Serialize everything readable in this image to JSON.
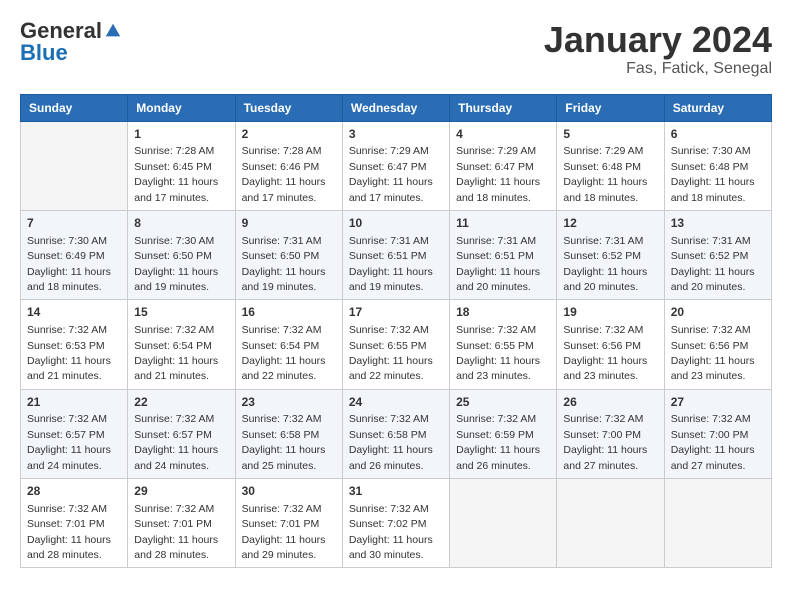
{
  "header": {
    "logo_general": "General",
    "logo_blue": "Blue",
    "month_year": "January 2024",
    "location": "Fas, Fatick, Senegal"
  },
  "days_of_week": [
    "Sunday",
    "Monday",
    "Tuesday",
    "Wednesday",
    "Thursday",
    "Friday",
    "Saturday"
  ],
  "weeks": [
    [
      {
        "day": "",
        "empty": true
      },
      {
        "day": "1",
        "sunrise": "7:28 AM",
        "sunset": "6:45 PM",
        "daylight": "11 hours and 17 minutes."
      },
      {
        "day": "2",
        "sunrise": "7:28 AM",
        "sunset": "6:46 PM",
        "daylight": "11 hours and 17 minutes."
      },
      {
        "day": "3",
        "sunrise": "7:29 AM",
        "sunset": "6:47 PM",
        "daylight": "11 hours and 17 minutes."
      },
      {
        "day": "4",
        "sunrise": "7:29 AM",
        "sunset": "6:47 PM",
        "daylight": "11 hours and 18 minutes."
      },
      {
        "day": "5",
        "sunrise": "7:29 AM",
        "sunset": "6:48 PM",
        "daylight": "11 hours and 18 minutes."
      },
      {
        "day": "6",
        "sunrise": "7:30 AM",
        "sunset": "6:48 PM",
        "daylight": "11 hours and 18 minutes."
      }
    ],
    [
      {
        "day": "7",
        "sunrise": "7:30 AM",
        "sunset": "6:49 PM",
        "daylight": "11 hours and 18 minutes."
      },
      {
        "day": "8",
        "sunrise": "7:30 AM",
        "sunset": "6:50 PM",
        "daylight": "11 hours and 19 minutes."
      },
      {
        "day": "9",
        "sunrise": "7:31 AM",
        "sunset": "6:50 PM",
        "daylight": "11 hours and 19 minutes."
      },
      {
        "day": "10",
        "sunrise": "7:31 AM",
        "sunset": "6:51 PM",
        "daylight": "11 hours and 19 minutes."
      },
      {
        "day": "11",
        "sunrise": "7:31 AM",
        "sunset": "6:51 PM",
        "daylight": "11 hours and 20 minutes."
      },
      {
        "day": "12",
        "sunrise": "7:31 AM",
        "sunset": "6:52 PM",
        "daylight": "11 hours and 20 minutes."
      },
      {
        "day": "13",
        "sunrise": "7:31 AM",
        "sunset": "6:52 PM",
        "daylight": "11 hours and 20 minutes."
      }
    ],
    [
      {
        "day": "14",
        "sunrise": "7:32 AM",
        "sunset": "6:53 PM",
        "daylight": "11 hours and 21 minutes."
      },
      {
        "day": "15",
        "sunrise": "7:32 AM",
        "sunset": "6:54 PM",
        "daylight": "11 hours and 21 minutes."
      },
      {
        "day": "16",
        "sunrise": "7:32 AM",
        "sunset": "6:54 PM",
        "daylight": "11 hours and 22 minutes."
      },
      {
        "day": "17",
        "sunrise": "7:32 AM",
        "sunset": "6:55 PM",
        "daylight": "11 hours and 22 minutes."
      },
      {
        "day": "18",
        "sunrise": "7:32 AM",
        "sunset": "6:55 PM",
        "daylight": "11 hours and 23 minutes."
      },
      {
        "day": "19",
        "sunrise": "7:32 AM",
        "sunset": "6:56 PM",
        "daylight": "11 hours and 23 minutes."
      },
      {
        "day": "20",
        "sunrise": "7:32 AM",
        "sunset": "6:56 PM",
        "daylight": "11 hours and 23 minutes."
      }
    ],
    [
      {
        "day": "21",
        "sunrise": "7:32 AM",
        "sunset": "6:57 PM",
        "daylight": "11 hours and 24 minutes."
      },
      {
        "day": "22",
        "sunrise": "7:32 AM",
        "sunset": "6:57 PM",
        "daylight": "11 hours and 24 minutes."
      },
      {
        "day": "23",
        "sunrise": "7:32 AM",
        "sunset": "6:58 PM",
        "daylight": "11 hours and 25 minutes."
      },
      {
        "day": "24",
        "sunrise": "7:32 AM",
        "sunset": "6:58 PM",
        "daylight": "11 hours and 26 minutes."
      },
      {
        "day": "25",
        "sunrise": "7:32 AM",
        "sunset": "6:59 PM",
        "daylight": "11 hours and 26 minutes."
      },
      {
        "day": "26",
        "sunrise": "7:32 AM",
        "sunset": "7:00 PM",
        "daylight": "11 hours and 27 minutes."
      },
      {
        "day": "27",
        "sunrise": "7:32 AM",
        "sunset": "7:00 PM",
        "daylight": "11 hours and 27 minutes."
      }
    ],
    [
      {
        "day": "28",
        "sunrise": "7:32 AM",
        "sunset": "7:01 PM",
        "daylight": "11 hours and 28 minutes."
      },
      {
        "day": "29",
        "sunrise": "7:32 AM",
        "sunset": "7:01 PM",
        "daylight": "11 hours and 28 minutes."
      },
      {
        "day": "30",
        "sunrise": "7:32 AM",
        "sunset": "7:01 PM",
        "daylight": "11 hours and 29 minutes."
      },
      {
        "day": "31",
        "sunrise": "7:32 AM",
        "sunset": "7:02 PM",
        "daylight": "11 hours and 30 minutes."
      },
      {
        "day": "",
        "empty": true
      },
      {
        "day": "",
        "empty": true
      },
      {
        "day": "",
        "empty": true
      }
    ]
  ]
}
